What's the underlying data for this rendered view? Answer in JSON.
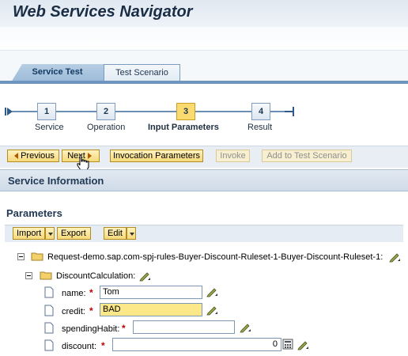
{
  "header": {
    "title": "Web Services Navigator"
  },
  "tabs": [
    {
      "label": "Service Test",
      "active": true
    },
    {
      "label": "Test Scenario",
      "active": false
    }
  ],
  "roadmap": {
    "steps": [
      {
        "number": "1",
        "label": "Service",
        "active": false
      },
      {
        "number": "2",
        "label": "Operation",
        "active": false
      },
      {
        "number": "3",
        "label": "Input Parameters",
        "active": true
      },
      {
        "number": "4",
        "label": "Result",
        "active": false
      }
    ]
  },
  "toolbar": {
    "previous_label": "Previous",
    "next_label": "Next",
    "invocation_label": "Invocation Parameters",
    "invoke_label": "Invoke",
    "add_scenario_label": "Add to Test Scenario"
  },
  "service_info": {
    "title": "Service Information"
  },
  "parameters": {
    "title": "Parameters",
    "import_label": "Import",
    "export_label": "Export",
    "edit_label": "Edit",
    "tree": {
      "root_label": "Request-demo.sap.com-spj-rules-Buyer-Discount-Ruleset-1-Buyer-Discount-Ruleset-1:",
      "node_label": "DiscountCalculation:",
      "fields": [
        {
          "label": "name:",
          "value": "Tom"
        },
        {
          "label": "credit:",
          "value": "BAD"
        },
        {
          "label": "spendingHabit:",
          "value": ""
        },
        {
          "label": "discount:",
          "value": "0"
        }
      ]
    }
  },
  "colors": {
    "active_step": "#fbdb6f",
    "button_fill": "#f6d97b",
    "tab_active": "#9bbad8",
    "required_mark": "#c00000"
  }
}
